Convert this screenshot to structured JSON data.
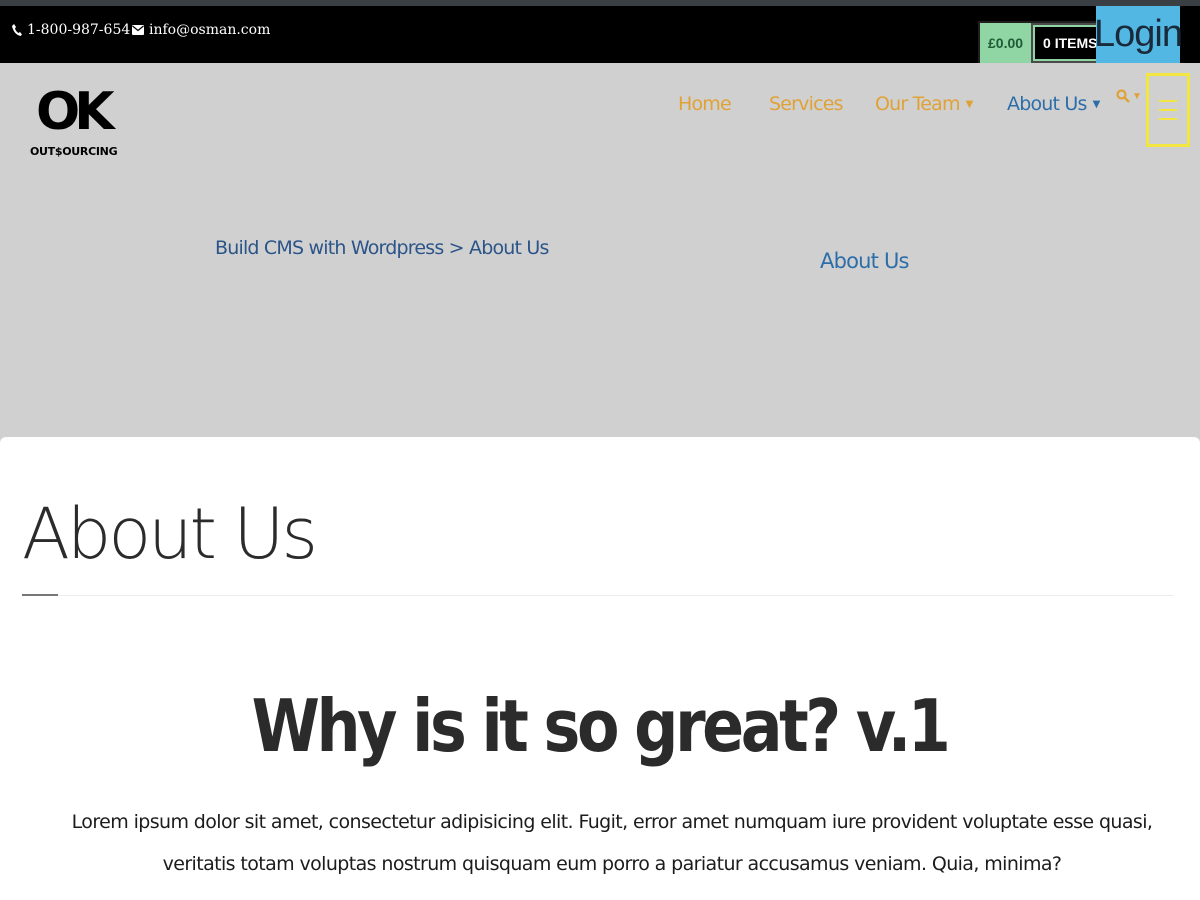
{
  "topbar": {
    "phone": "1-800-987-654",
    "email": "info@osman.com",
    "cart_amount": "£0.00",
    "cart_items": "0 ITEMS",
    "login_label": "Login"
  },
  "logo": {
    "mark": "OK",
    "word": "OUT$OURCING"
  },
  "nav": {
    "items": [
      {
        "label": "Home"
      },
      {
        "label": "Services"
      },
      {
        "label": "Our Team"
      },
      {
        "label": "About Us"
      }
    ]
  },
  "breadcrumb": "Build CMS with Wordpress > About Us",
  "header_title": "About Us",
  "content": {
    "page_title": "About Us",
    "heading": "Why is it so great? v.1",
    "paragraph": "Lorem ipsum dolor sit amet, consectetur adipisicing elit. Fugit, error amet numquam iure provident voluptate esse quasi, veritatis totam voluptas nostrum quisquam eum porro a pariatur accusamus veniam. Quia, minima?"
  },
  "colors": {
    "nav_orange": "#e0a236",
    "nav_blue": "#2d6ea8",
    "login_bg": "#52b7e3",
    "cart_green": "#8fd6a4",
    "menu_outline": "#f2e640"
  },
  "icons": [
    "phone-icon",
    "envelope-icon",
    "search-icon",
    "caret-down-icon",
    "hamburger-menu-icon"
  ]
}
